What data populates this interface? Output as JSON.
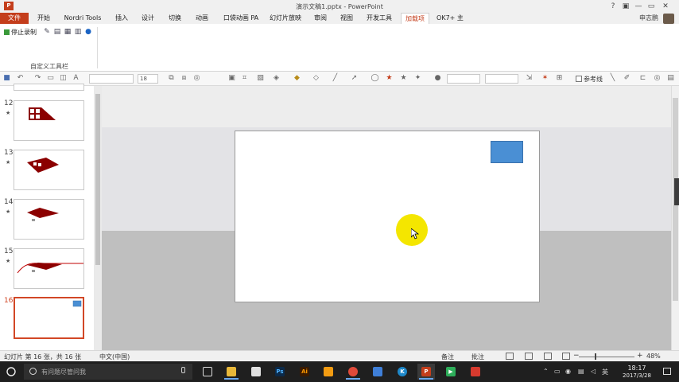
{
  "window": {
    "app_icon": "P",
    "title": "演示文稿1.pptx - PowerPoint",
    "help_glyph": "?",
    "ribbon_opts_glyph": "▣",
    "min_glyph": "—",
    "max_glyph": "▭",
    "close_glyph": "✕"
  },
  "tabs": [
    {
      "label": "文件"
    },
    {
      "label": "开始"
    },
    {
      "label": "Nordri Tools"
    },
    {
      "label": "插入"
    },
    {
      "label": "设计"
    },
    {
      "label": "切换"
    },
    {
      "label": "动画"
    },
    {
      "label": "口袋动画 PA"
    },
    {
      "label": "幻灯片放映"
    },
    {
      "label": "审阅"
    },
    {
      "label": "视图"
    },
    {
      "label": "开发工具"
    },
    {
      "label": "加载项"
    },
    {
      "label": "OK7+ 主"
    }
  ],
  "user": {
    "name": "申志鹏"
  },
  "ribbon": {
    "stop_record_label": "停止录制",
    "group_label": "自定义工具栏"
  },
  "toolbar2": {
    "font_size": "18",
    "reference_line_label": "参考线"
  },
  "slides": [
    {
      "number": "12",
      "marker": "★"
    },
    {
      "number": "13",
      "marker": "★"
    },
    {
      "number": "14",
      "marker": "★"
    },
    {
      "number": "15",
      "marker": "★"
    },
    {
      "number": "16",
      "marker": ""
    }
  ],
  "status": {
    "slide_info": "幻灯片 第 16 张，共 16 张",
    "language": "中文(中国)",
    "notes": "备注",
    "comments": "批注",
    "zoom": "48%"
  },
  "taskbar": {
    "search_placeholder": "有问题尽管问我",
    "ime": "英",
    "time": "18:17",
    "date": "2017/3/28"
  },
  "colors": {
    "accent": "#c43e1c",
    "shape_fill": "#4a8fd4",
    "highlight": "#f4e600",
    "thumb_shape": "#8b0000"
  }
}
